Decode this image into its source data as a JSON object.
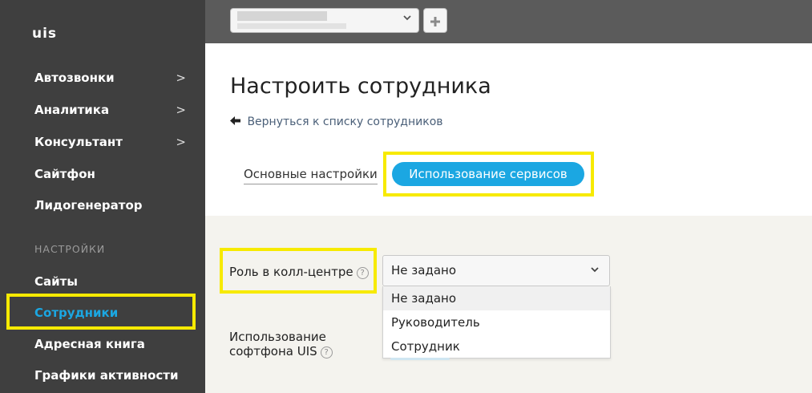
{
  "sidebar": {
    "logo": "uis",
    "items": [
      {
        "label": "Автозвонки",
        "chevron": ">"
      },
      {
        "label": "Аналитика",
        "chevron": ">"
      },
      {
        "label": "Консультант",
        "chevron": ">"
      },
      {
        "label": "Сайтфон"
      },
      {
        "label": "Лидогенератор"
      }
    ],
    "settings_heading": "НАСТРОЙКИ",
    "settings_items": [
      {
        "label": "Сайты"
      },
      {
        "label": "Сотрудники",
        "active": true
      },
      {
        "label": "Адресная книга"
      },
      {
        "label": "Графики активности"
      }
    ]
  },
  "topbar": {
    "company_select_icon": "chevron-down",
    "add_button_icon": "plus"
  },
  "header": {
    "title": "Настроить сотрудника",
    "back_link": "Вернуться к списку сотрудников",
    "tabs": [
      {
        "label": "Основные настройки",
        "active": false
      },
      {
        "label": "Использование сервисов",
        "active": true
      }
    ]
  },
  "form": {
    "role_label": "Роль в колл-центре",
    "role_value": "Не задано",
    "role_options": [
      "Не задано",
      "Руководитель",
      "Сотрудник"
    ],
    "softphone_label_line1": "Использование",
    "softphone_label_line2": "софтфона UIS",
    "help_glyph": "?"
  },
  "colors": {
    "sidebar_bg": "#3f3f3f",
    "topbar_bg": "#5b5b5b",
    "accent": "#1ba7e2",
    "highlight": "#f7ea00"
  }
}
